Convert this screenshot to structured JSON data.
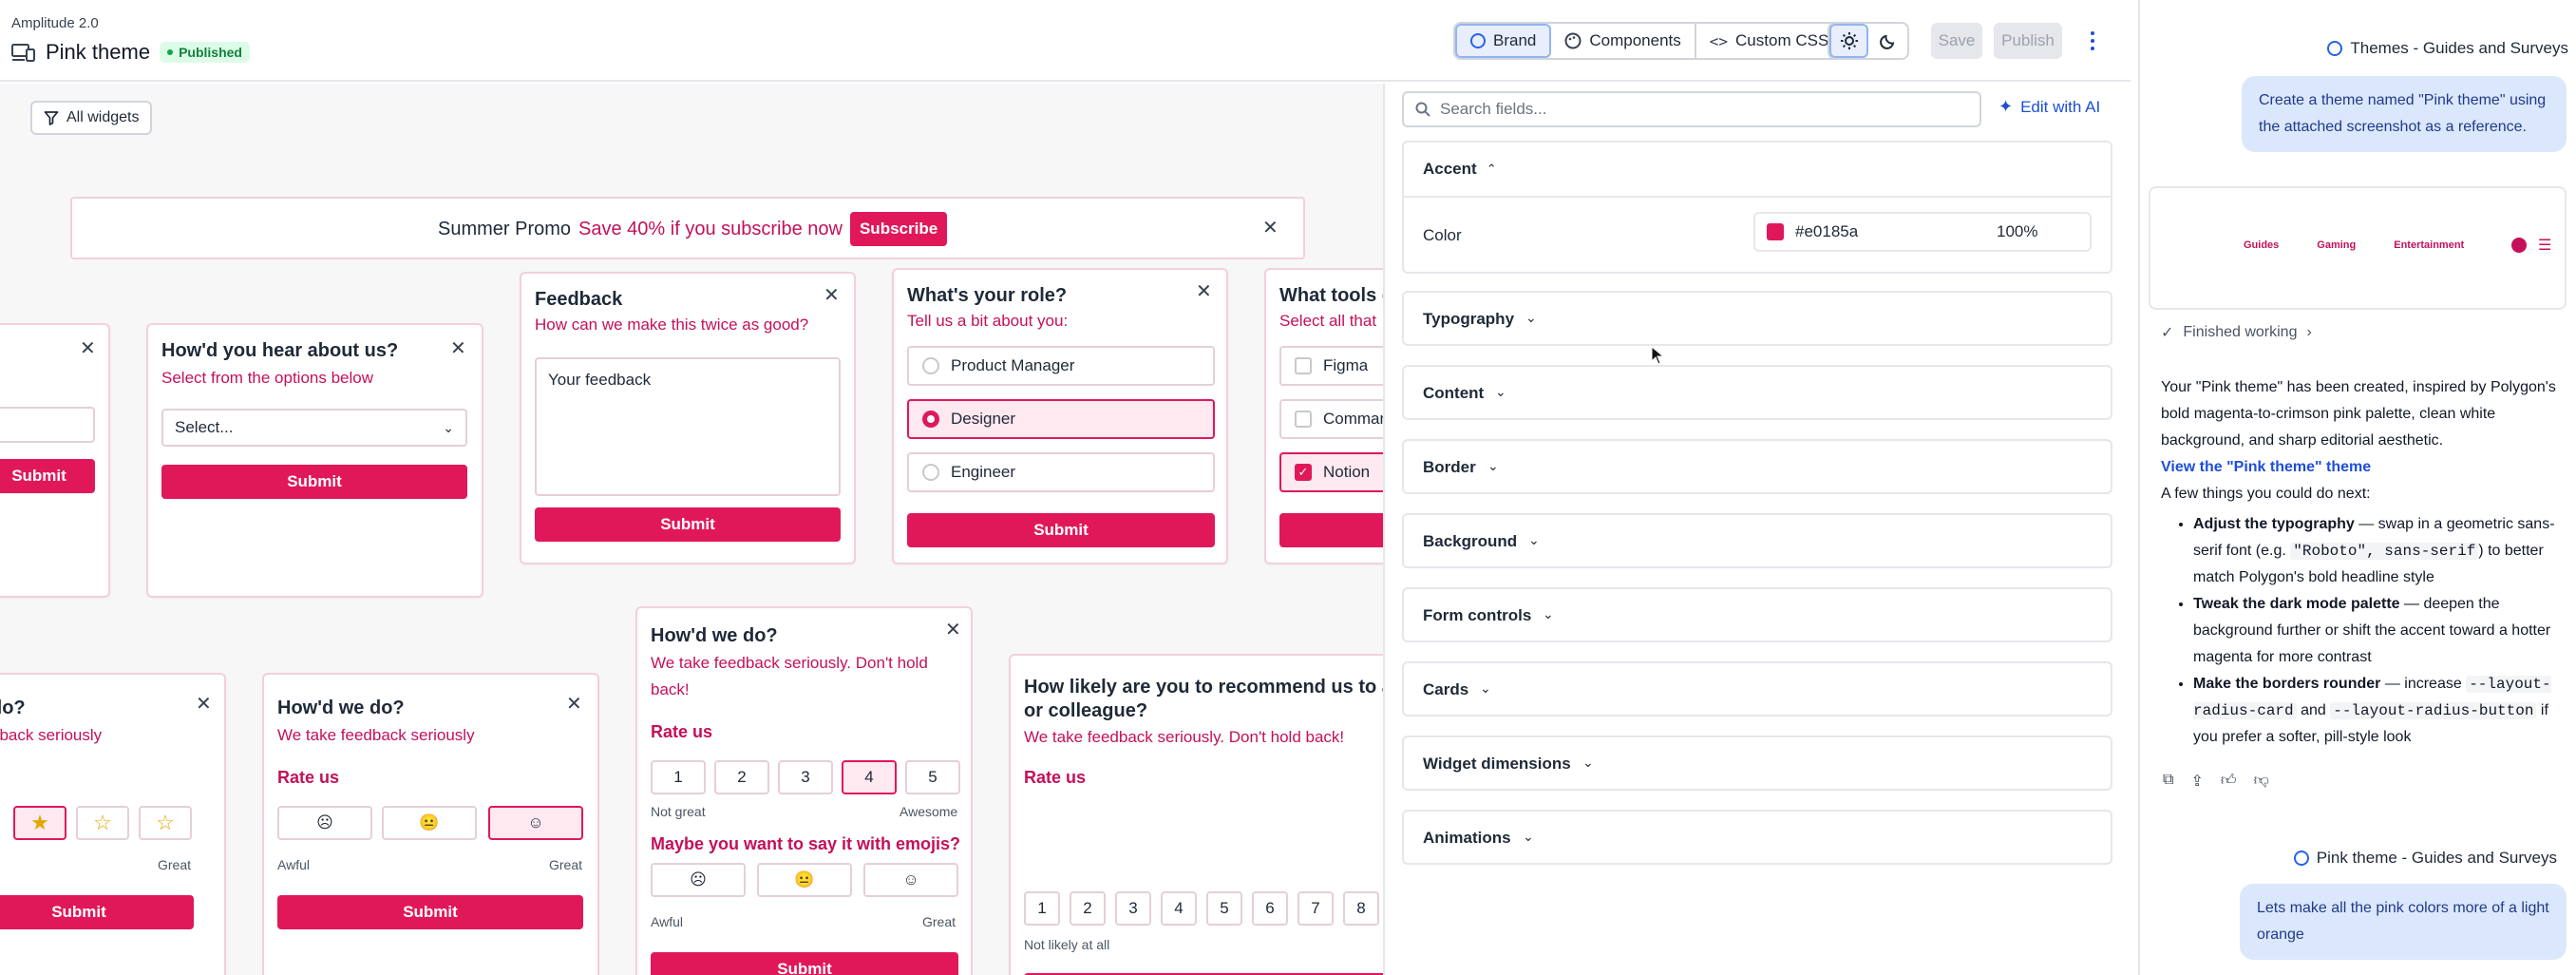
{
  "app": {
    "name": "Amplitude 2.0"
  },
  "header": {
    "title": "Pink theme",
    "status": "Published",
    "tabs": [
      {
        "label": "Brand"
      },
      {
        "label": "Components"
      },
      {
        "label": "Custom CSS"
      }
    ],
    "save_label": "Save",
    "publish_label": "Publish"
  },
  "canvas": {
    "filter_label": "All widgets",
    "promo": {
      "title": "Summer Promo",
      "text": "Save 40% if you subscribe now",
      "button": "Subscribe"
    },
    "submit_label": "Submit",
    "hear_card": {
      "title": "How'd you hear about us?",
      "subtitle": "Select from the options below",
      "select_value": "Select..."
    },
    "feedback_card": {
      "title": "Feedback",
      "subtitle": "How can we make this twice as good?",
      "placeholder": "Your feedback"
    },
    "role_card": {
      "title": "What's your role?",
      "subtitle": "Tell us a bit about you:",
      "options": [
        "Product Manager",
        "Designer",
        "Engineer"
      ]
    },
    "tools_card": {
      "title": "What tools d",
      "subtitle": "Select all that",
      "options": [
        "Figma",
        "Comman",
        "Notion"
      ]
    },
    "left_partial": {
      "title": "do?",
      "subtitle": "dback seriously",
      "great": "Great"
    },
    "rating_card": {
      "title": "How'd we do?",
      "subtitle": "We take feedback seriously",
      "rate_label": "Rate us",
      "low": "Awful",
      "high": "Great"
    },
    "scale_card": {
      "title": "How'd we do?",
      "subtitle": "We take feedback seriously. Don't hold back!",
      "rate_label": "Rate us",
      "numbers": [
        "1",
        "2",
        "3",
        "4",
        "5"
      ],
      "low": "Not great",
      "high": "Awesome",
      "emoji_q": "Maybe you want to say it with emojis?",
      "emoji_low": "Awful",
      "emoji_high": "Great"
    },
    "nps_card": {
      "title_l1": "How likely are you to recommend us to a fr",
      "title_l2": "or colleague?",
      "subtitle": "We take feedback seriously. Don't hold back!",
      "rate_label": "Rate us",
      "numbers": [
        "1",
        "2",
        "3",
        "4",
        "5",
        "6",
        "7",
        "8"
      ],
      "low": "Not likely at all"
    }
  },
  "panel": {
    "search_placeholder": "Search fields...",
    "edit_ai_label": "Edit with AI",
    "accent": {
      "label": "Accent",
      "color_label": "Color",
      "color_value": "#e0185a",
      "opacity": "100%"
    },
    "sections": [
      "Typography",
      "Content",
      "Border",
      "Background",
      "Form controls",
      "Cards",
      "Widget dimensions",
      "Animations"
    ]
  },
  "chat": {
    "context_1": "Themes - Guides and Surveys",
    "user_msg_1": "Create a theme named \"Pink theme\" using the attached screenshot as a reference.",
    "preview_nav": [
      "Guides",
      "Gaming",
      "Entertainment"
    ],
    "status": "Finished working",
    "reply_intro": "Your \"Pink theme\" has been created, inspired by Polygon's bold magenta-to-crimson pink palette, clean white background, and sharp editorial aesthetic.",
    "link": "View the \"Pink theme\" theme",
    "next_label": "A few things you could do next:",
    "bullets": [
      {
        "bold": "Adjust the typography",
        "pre": " — swap in a geometric sans-serif font (e.g. ",
        "code": "\"Roboto\", sans-serif",
        "post": ") to better match Polygon's bold headline style"
      },
      {
        "bold": "Tweak the dark mode palette",
        "text": " — deepen the background further or shift the accent toward a hotter magenta for more contrast"
      },
      {
        "bold": "Make the borders rounder",
        "pre": " — increase ",
        "code": "--layout-radius-card",
        "mid": " and ",
        "code2": "--layout-radius-button",
        "post": " if you prefer a softer, pill-style look"
      }
    ],
    "context_2": "Pink theme - Guides and Surveys",
    "user_msg_2": "Lets make all the pink colors more of a light orange"
  },
  "colors": {
    "accent": "#e0185a",
    "accent_text": "#c4105a",
    "chat_bubble": "#dbe7fb"
  }
}
